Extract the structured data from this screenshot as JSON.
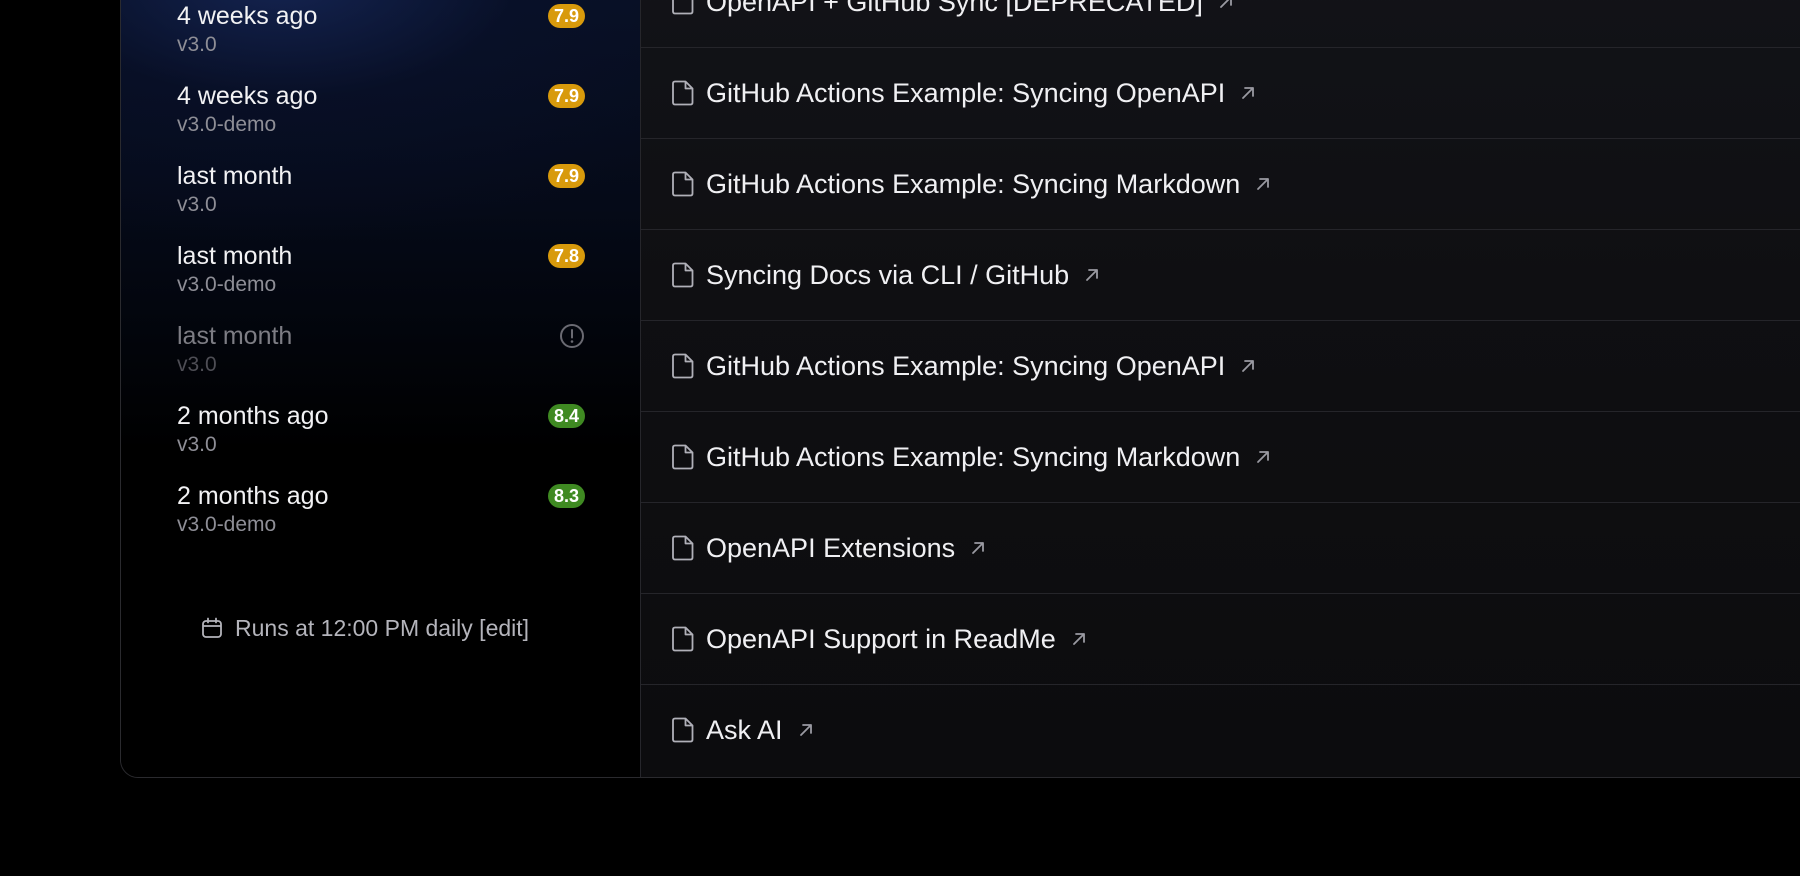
{
  "runs": [
    {
      "time": "4 weeks ago",
      "branch": "v3.0",
      "score": "7.9",
      "status": "yellow"
    },
    {
      "time": "4 weeks ago",
      "branch": "v3.0-demo",
      "score": "7.9",
      "status": "yellow"
    },
    {
      "time": "last month",
      "branch": "v3.0",
      "score": "7.9",
      "status": "yellow"
    },
    {
      "time": "last month",
      "branch": "v3.0-demo",
      "score": "7.8",
      "status": "yellow"
    },
    {
      "time": "last month",
      "branch": "v3.0",
      "score": null,
      "status": "error"
    },
    {
      "time": "2 months ago",
      "branch": "v3.0",
      "score": "8.4",
      "status": "green"
    },
    {
      "time": "2 months ago",
      "branch": "v3.0-demo",
      "score": "8.3",
      "status": "green"
    }
  ],
  "schedule": {
    "text": "Runs at 12:00 PM daily [edit]",
    "icon": "calendar-icon"
  },
  "docs": [
    {
      "title": "OpenAPI + GitHub Sync [DEPRECATED]"
    },
    {
      "title": "GitHub Actions Example: Syncing OpenAPI"
    },
    {
      "title": "GitHub Actions Example: Syncing Markdown"
    },
    {
      "title": "Syncing Docs via CLI / GitHub"
    },
    {
      "title": "GitHub Actions Example: Syncing OpenAPI"
    },
    {
      "title": "GitHub Actions Example: Syncing Markdown"
    },
    {
      "title": "OpenAPI Extensions"
    },
    {
      "title": "OpenAPI Support in ReadMe"
    },
    {
      "title": "Ask AI"
    }
  ],
  "colors": {
    "badge_yellow": "#d89a0c",
    "badge_green": "#3f8a22",
    "page_background": "#000000"
  }
}
